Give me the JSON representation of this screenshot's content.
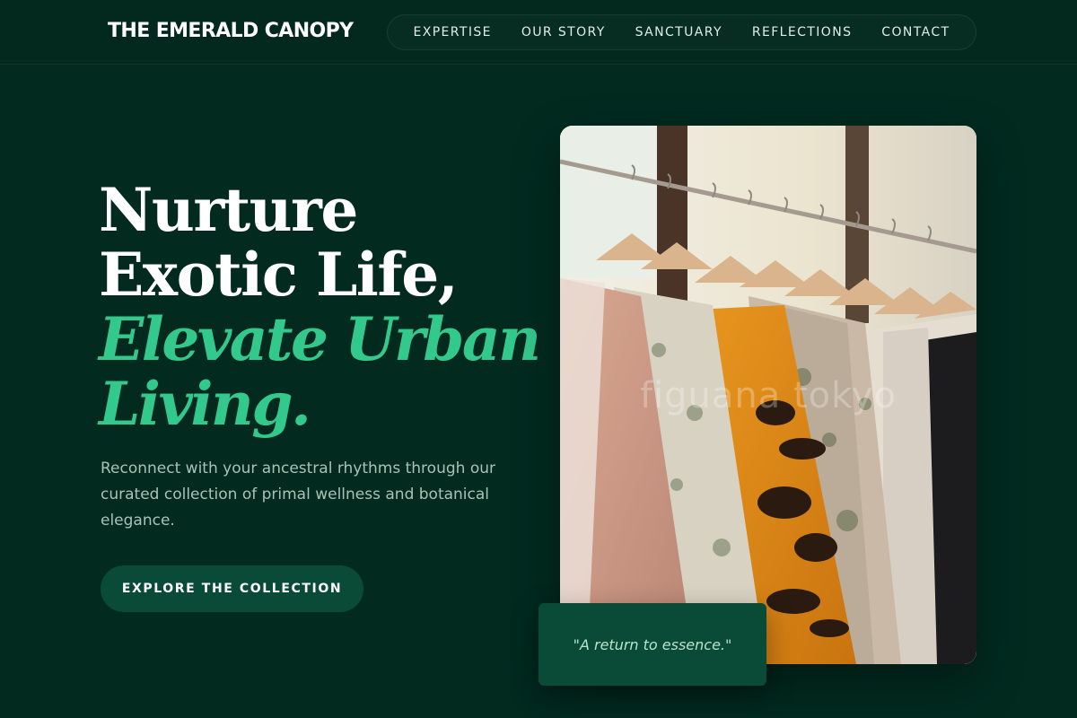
{
  "header": {
    "brand": "THE EMERALD CANOPY",
    "nav": [
      "EXPERTISE",
      "OUR STORY",
      "SANCTUARY",
      "REFLECTIONS",
      "CONTACT"
    ]
  },
  "hero": {
    "headline_white": [
      "Nurture",
      "Exotic Life,"
    ],
    "headline_green": [
      "Elevate Urban",
      "Living."
    ],
    "subtext": "Reconnect with your ancestral rhythms through our curated collection of primal wellness and botanical elegance.",
    "cta_label": "EXPLORE THE COLLECTION",
    "image_watermark": "figuana tokyo",
    "quote": "\"A return to essence.\""
  },
  "colors": {
    "background": "#022a1f",
    "accent": "#34c98c",
    "button": "#0a4b37",
    "subtext": "#a9c2b6"
  },
  "icons": {
    "hero_image": "clothing-rack-photo"
  }
}
